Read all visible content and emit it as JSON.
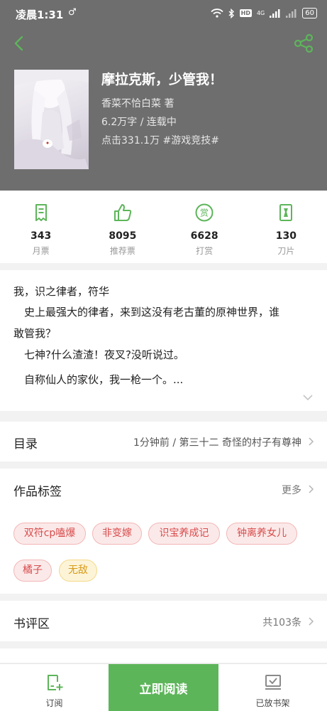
{
  "status_bar": {
    "time": "凌晨1:31",
    "extra": "♂",
    "network": "4G",
    "battery": "60"
  },
  "nav": {
    "back_icon": "chevron-left-icon",
    "share_icon": "share-icon",
    "accent_color": "#5db55a"
  },
  "book": {
    "title": "摩拉克斯，少管我！",
    "author": "香菜不恰白菜",
    "author_suffix": "著",
    "word_count": "6.2万字",
    "separator": "/",
    "status": "连载中",
    "clicks": "点击331.1万",
    "genre_tag": "#游戏竞技#"
  },
  "stats": [
    {
      "icon": "monthly-ticket-icon",
      "value": "343",
      "label": "月票"
    },
    {
      "icon": "thumbs-up-icon",
      "value": "8095",
      "label": "推荐票"
    },
    {
      "icon": "reward-icon",
      "value": "6628",
      "label": "打赏"
    },
    {
      "icon": "blade-icon",
      "value": "130",
      "label": "刀片"
    }
  ],
  "synopsis": {
    "lines": [
      "我，识之律者，符华",
      "　史上最强大的律者，来到这没有老古董的原神世界，谁",
      "敢管我？",
      "　七神?什么渣渣！夜叉?没听说过。",
      "　自称仙人的家伙，我一枪一个。..."
    ]
  },
  "toc": {
    "title": "目录",
    "latest": "1分钟前 / 第三十二 奇怪的村子有尊神"
  },
  "tags": {
    "title": "作品标签",
    "more": "更多",
    "items": [
      {
        "label": "双符cp嗑爆",
        "color": "red"
      },
      {
        "label": "非变嫁",
        "color": "red"
      },
      {
        "label": "识宝养成记",
        "color": "red"
      },
      {
        "label": "钟离养女儿",
        "color": "red"
      },
      {
        "label": "橘子",
        "color": "red"
      },
      {
        "label": "无敌",
        "color": "yellow"
      }
    ]
  },
  "reviews": {
    "title": "书评区",
    "count": "共103条"
  },
  "bottom_bar": {
    "subscribe": "订阅",
    "read_now": "立即阅读",
    "on_shelf": "已放书架"
  }
}
